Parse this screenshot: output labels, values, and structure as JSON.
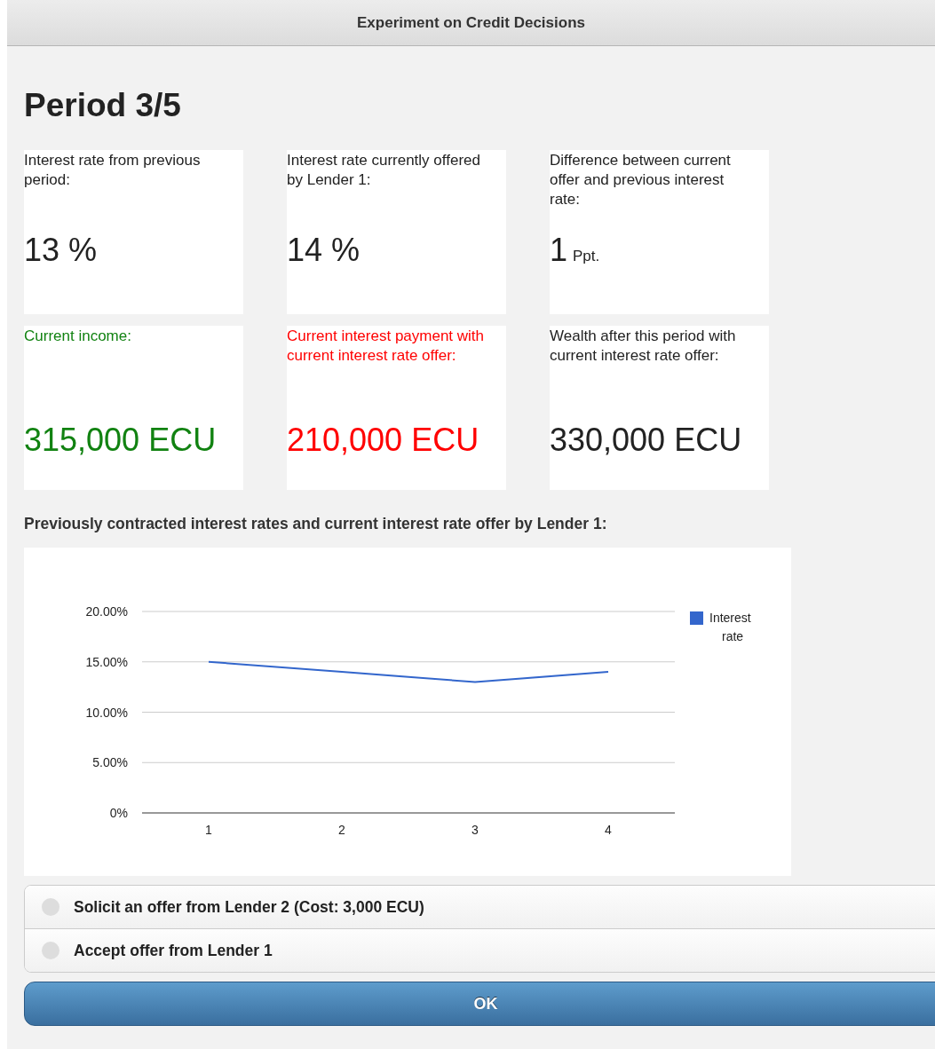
{
  "window": {
    "title": "Experiment on Credit Decisions"
  },
  "heading": "Period 3/5",
  "cards": [
    {
      "label": "Interest rate from previous period:",
      "value": "13 %",
      "color": "#222222"
    },
    {
      "label": "Interest rate currently offered by Lender 1:",
      "value": "14 %",
      "color": "#222222"
    },
    {
      "label": "Difference between current offer and previous interest rate:",
      "value": "1",
      "unit": "Ppt.",
      "color": "#222222"
    },
    {
      "label": "Current income:",
      "value": "315,000 ECU",
      "color": "#118211"
    },
    {
      "label": "Current interest payment with current interest rate offer:",
      "value": "210,000 ECU",
      "color": "#ff0000"
    },
    {
      "label": "Wealth after this period with current interest rate offer:",
      "value": "330,000 ECU",
      "color": "#222222"
    }
  ],
  "chart_section": {
    "title": "Previously contracted interest rates and current interest rate offer by Lender 1:",
    "chart_data": {
      "type": "line",
      "categories": [
        "1",
        "2",
        "3",
        "4"
      ],
      "series": [
        {
          "name": "Interest rate",
          "color": "#3366cc",
          "values": [
            15,
            14,
            13,
            14
          ]
        }
      ],
      "ylim": [
        0,
        20
      ],
      "grid": true,
      "yticks": [
        {
          "value": 0,
          "label": "0%"
        },
        {
          "value": 5,
          "label": "5.00%"
        },
        {
          "value": 10,
          "label": "10.00%"
        },
        {
          "value": 15,
          "label": "15.00%"
        },
        {
          "value": 20,
          "label": "20.00%"
        }
      ]
    }
  },
  "options": [
    {
      "label": "Solicit an offer from Lender 2 (Cost: 3,000 ECU)",
      "selected": false
    },
    {
      "label": "Accept offer from Lender 1",
      "selected": false
    }
  ],
  "ok_button": "OK"
}
